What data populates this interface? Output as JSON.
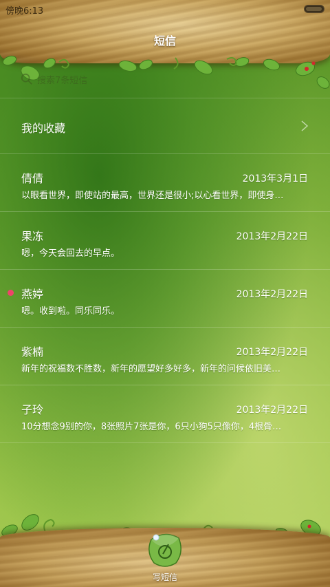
{
  "status_bar": {
    "time": "傍晚6:13"
  },
  "header": {
    "title": "短信"
  },
  "search": {
    "placeholder": "搜索7条短信"
  },
  "favorites": {
    "label": "我的收藏"
  },
  "messages": [
    {
      "name": "倩倩",
      "date": "2013年3月1日",
      "preview": "以眼看世界，即使站的最高，世界还是很小;以心看世界，即使身…",
      "unread": false
    },
    {
      "name": "果冻",
      "date": "2013年2月22日",
      "preview": "嗯，今天会回去的早点。",
      "unread": false
    },
    {
      "name": "燕婷",
      "date": "2013年2月22日",
      "preview": "嗯。收到啦。同乐同乐。",
      "unread": true
    },
    {
      "name": "紫楠",
      "date": "2013年2月22日",
      "preview": "新年的祝福数不胜数，新年的愿望好多好多，新年的问候依旧美…",
      "unread": false
    },
    {
      "name": "子玲",
      "date": "2013年2月22日",
      "preview": "10分想念9别的你，8张照片7张是你，6只小狗5只像你，4根骨…",
      "unread": false
    }
  ],
  "bottom_bar": {
    "compose_label": "写短信"
  },
  "colors": {
    "unread": "#f0436a",
    "text": "#ffffff",
    "wood": "#c9a660",
    "leaf": "#6db33a"
  },
  "icons": {
    "search": "search-icon",
    "chevron": "chevron-right-icon",
    "compose": "compose-leaf-icon"
  }
}
